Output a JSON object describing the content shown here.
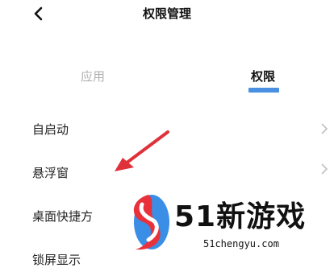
{
  "header": {
    "title": "权限管理",
    "back_icon": "chevron-left-icon"
  },
  "tabs": [
    {
      "label": "应用",
      "active": false
    },
    {
      "label": "权限",
      "active": true
    }
  ],
  "accent_color": "#4a90e2",
  "annotation_color": "#e0313a",
  "list": {
    "items": [
      {
        "label": "自启动",
        "chevron": true
      },
      {
        "label": "悬浮窗",
        "chevron": true
      },
      {
        "label": "桌面快捷方",
        "chevron": false
      },
      {
        "label": "锁屏显示",
        "chevron": false
      }
    ]
  },
  "watermark": {
    "name": "51新游戏",
    "url": "51chengyu.com"
  }
}
